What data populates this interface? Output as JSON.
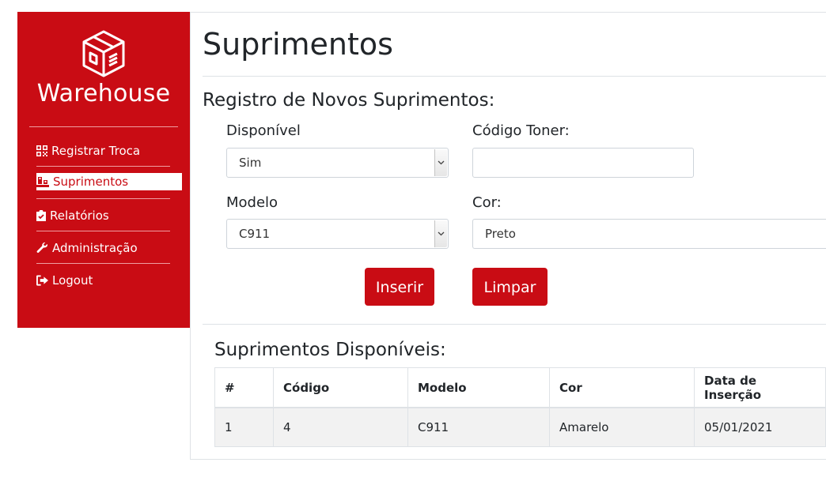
{
  "sidebar": {
    "brand": "Warehouse",
    "logo_icon": "package-box-icon",
    "items": [
      {
        "label": "Registrar Troca",
        "icon": "qrcode-icon"
      },
      {
        "label": "Suprimentos",
        "icon": "pallet-boxes-icon",
        "active": true
      },
      {
        "label": "Relatórios",
        "icon": "clipboard-check-icon"
      },
      {
        "label": "Administração",
        "icon": "wrench-icon"
      },
      {
        "label": "Logout",
        "icon": "sign-out-icon"
      }
    ]
  },
  "main": {
    "title": "Suprimentos",
    "form_title": "Registro de Novos Suprimentos:",
    "form": {
      "disponivel_label": "Disponível",
      "disponivel_value": "Sim",
      "codigo_label": "Código Toner:",
      "codigo_value": "",
      "modelo_label": "Modelo",
      "modelo_value": "C911",
      "cor_label": "Cor:",
      "cor_value": "Preto",
      "insert_button": "Inserir",
      "clear_button": "Limpar"
    },
    "table_title": "Suprimentos Disponíveis:",
    "table": {
      "headers": [
        "#",
        "Código",
        "Modelo",
        "Cor",
        "Data de Inserção"
      ],
      "rows": [
        [
          "1",
          "4",
          "C911",
          "Amarelo",
          "05/01/2021"
        ]
      ]
    }
  },
  "colors": {
    "brand_red": "#c90c14",
    "row_stripe": "#f2f2f2"
  }
}
